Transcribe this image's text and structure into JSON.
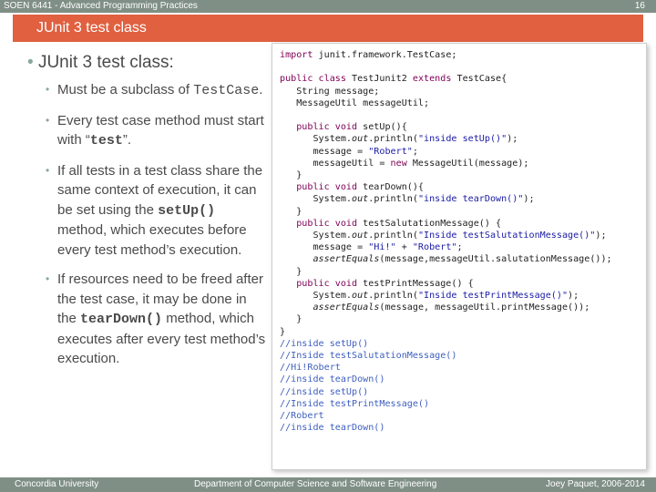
{
  "header": {
    "course": "SOEN 6441 - Advanced Programming Practices",
    "page_number": "16"
  },
  "slide": {
    "title": "JUnit 3 test class"
  },
  "bullets": {
    "main": "JUnit 3 test class:",
    "items": [
      {
        "pre": "Must be a subclass of ",
        "code": "TestCase",
        "post": "."
      },
      {
        "pre": "Every test case method must start with “",
        "code": "test",
        "post": "”."
      },
      {
        "pre": "If all tests in a test class share the same context of execution, it can be set using the ",
        "code": "setUp()",
        "post": " method, which executes before every test method’s execution."
      },
      {
        "pre": "If resources need to be freed after the test case, it may be done in the ",
        "code": "tearDown()",
        "post": " method, which executes after every test method’s execution."
      }
    ]
  },
  "code": {
    "l1_kw": "import",
    "l1_rest": " junit.framework.TestCase;",
    "l3_kw1": "public class",
    "l3_mid": " TestJunit2 ",
    "l3_kw2": "extends",
    "l3_rest": " TestCase{",
    "l4": "   String message;",
    "l5": "   MessageUtil messageUtil;",
    "l7_kw": "   public void",
    "l7_rest": " setUp(){",
    "l8_a": "      System.",
    "l8_out": "out",
    "l8_b": ".println(",
    "l8_str": "\"inside setUp()\"",
    "l8_c": ");",
    "l9_a": "      message = ",
    "l9_str": "\"Robert\"",
    "l9_c": ";",
    "l10_a": "      messageUtil = ",
    "l10_kw": "new",
    "l10_c": " MessageUtil(message);",
    "l11": "   }",
    "l12_kw": "   public void",
    "l12_rest": " tearDown(){",
    "l13_a": "      System.",
    "l13_out": "out",
    "l13_b": ".println(",
    "l13_str": "\"inside tearDown()\"",
    "l13_c": ");",
    "l14": "   }",
    "l15_kw": "   public void",
    "l15_rest": " testSalutationMessage() {",
    "l16_a": "      System.",
    "l16_out": "out",
    "l16_b": ".println(",
    "l16_str": "\"Inside testSalutationMessage()\"",
    "l16_c": ");",
    "l17_a": "      message = ",
    "l17_str1": "\"Hi!\"",
    "l17_b": " + ",
    "l17_str2": "\"Robert\"",
    "l17_c": ";",
    "l18_a": "      ",
    "l18_it": "assertEquals",
    "l18_b": "(message,messageUtil.salutationMessage());",
    "l19": "   }",
    "l20_kw": "   public void",
    "l20_rest": " testPrintMessage() {",
    "l21_a": "      System.",
    "l21_out": "out",
    "l21_b": ".println(",
    "l21_str": "\"Inside testPrintMessage()\"",
    "l21_c": ");",
    "l22_a": "      ",
    "l22_it": "assertEquals",
    "l22_b": "(message, messageUtil.printMessage());",
    "l23": "   }",
    "l24": "}",
    "output": [
      "//inside setUp()",
      "//Inside testSalutationMessage()",
      "//Hi!Robert",
      "//inside tearDown()",
      "//inside setUp()",
      "//Inside testPrintMessage()",
      "//Robert",
      "//inside tearDown()"
    ]
  },
  "footer": {
    "left": "Concordia University",
    "center": "Department of Computer Science and Software Engineering",
    "right": "Joey Paquet, 2006-2014"
  },
  "colors": {
    "header_bar": "#7f8f86",
    "title_bar": "#e06040",
    "bullet": "#8aa89a"
  }
}
